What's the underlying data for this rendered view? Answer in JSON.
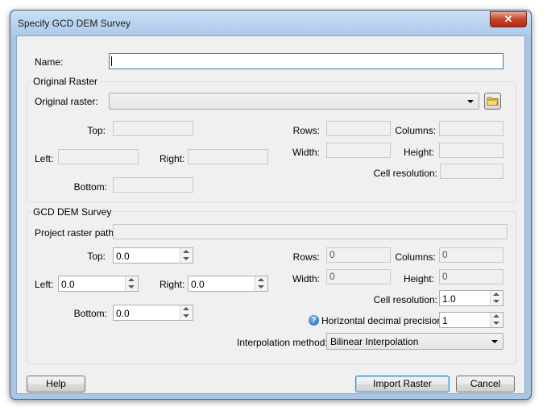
{
  "window": {
    "title": "Specify GCD DEM Survey",
    "close_glyph": "✕"
  },
  "name_field": {
    "label": "Name:",
    "value": ""
  },
  "original_raster": {
    "group_title": "Original Raster",
    "raster_label": "Original raster:",
    "raster_value": "",
    "top_label": "Top:",
    "left_label": "Left:",
    "right_label": "Right:",
    "bottom_label": "Bottom:",
    "rows_label": "Rows:",
    "columns_label": "Columns:",
    "width_label": "Width:",
    "height_label": "Height:",
    "cell_resolution_label": "Cell resolution:"
  },
  "gcd_survey": {
    "group_title": "GCD DEM Survey",
    "project_path_label": "Project raster path:",
    "project_path_value": "",
    "top_label": "Top:",
    "top_value": "0.0",
    "left_label": "Left:",
    "left_value": "0.0",
    "right_label": "Right:",
    "right_value": "0.0",
    "bottom_label": "Bottom:",
    "bottom_value": "0.0",
    "rows_label": "Rows:",
    "rows_value": "0",
    "columns_label": "Columns:",
    "columns_value": "0",
    "width_label": "Width:",
    "width_value": "0",
    "height_label": "Height:",
    "height_value": "0",
    "cell_resolution_label": "Cell resolution:",
    "cell_resolution_value": "1.0",
    "precision_label": "Horizontal decimal precision:",
    "precision_value": "1",
    "interpolation_label": "Interpolation method:",
    "interpolation_value": "Bilinear Interpolation"
  },
  "buttons": {
    "help": "Help",
    "import": "Import Raster",
    "cancel": "Cancel"
  },
  "icons": {
    "help_icon_glyph": "?"
  }
}
